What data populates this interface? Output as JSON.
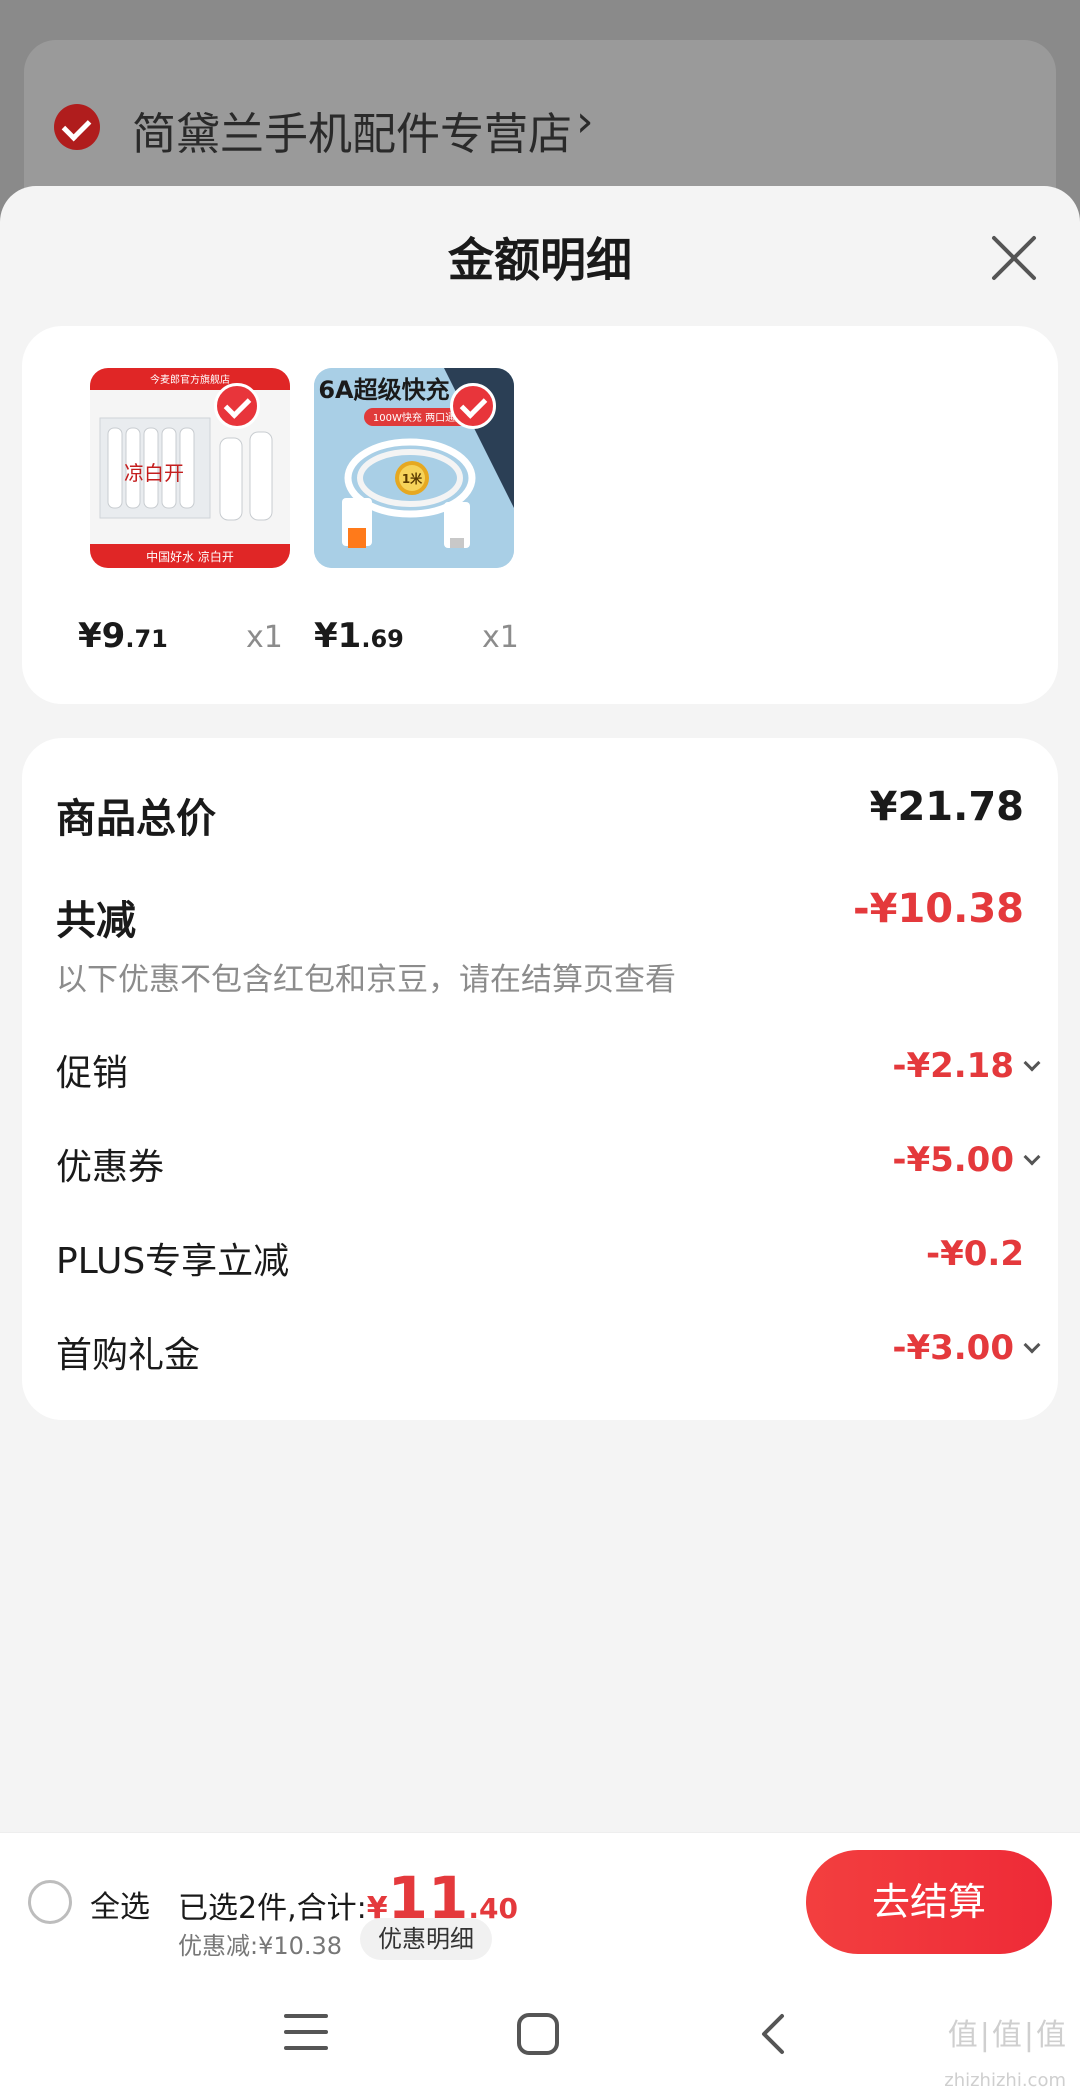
{
  "background": {
    "store_name": "简黛兰手机配件专营店",
    "store_arrow": "›"
  },
  "sheet": {
    "title": "金额明细"
  },
  "products": [
    {
      "price_int": "¥9",
      "price_dec": ".71",
      "qty": "x1",
      "image_top_text": "今麦郎官方旗舰店",
      "image_brand_text": "凉白开",
      "image_bottom_text": "中国好水 凉白开"
    },
    {
      "price_int": "¥1",
      "price_dec": ".69",
      "qty": "x1",
      "image_top_text": "6A超级快充",
      "image_sub_text": "100W快充 两口通用",
      "image_badge_text": "1米"
    }
  ],
  "summary": {
    "total_label": "商品总价",
    "total_value": "¥21.78",
    "reduce_label": "共减",
    "reduce_value": "-¥10.38",
    "reduce_note": "以下优惠不包含红包和京豆，请在结算页查看",
    "items": [
      {
        "label": "促销",
        "value": "-¥2.18",
        "expandable": true
      },
      {
        "label": "优惠券",
        "value": "-¥5.00",
        "expandable": true
      },
      {
        "label": "PLUS专享立减",
        "value": "-¥0.2",
        "expandable": false
      },
      {
        "label": "首购礼金",
        "value": "-¥3.00",
        "expandable": true
      }
    ]
  },
  "action_bar": {
    "select_all": "全选",
    "selected_text": "已选2件,合计:",
    "total_yuan": "¥",
    "total_big": "11",
    "total_dec": ".40",
    "discount_text": "优惠减:¥10.38",
    "detail_button": "优惠明细",
    "checkout_button": "去结算"
  },
  "watermark": {
    "main": "值|值|值",
    "sub": "zhizhizhi.com"
  },
  "colors": {
    "accent_red": "#e4393c",
    "checkout_red": "#f33f3f",
    "sheet_bg": "#f4f4f4"
  }
}
